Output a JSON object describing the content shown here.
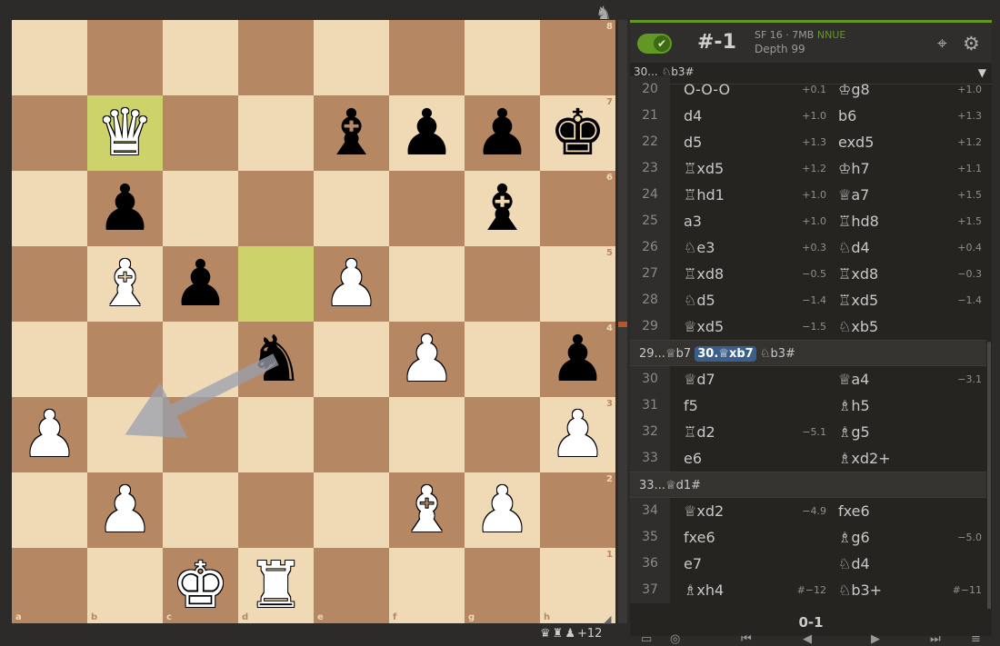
{
  "board": {
    "files": [
      "a",
      "b",
      "c",
      "d",
      "e",
      "f",
      "g",
      "h"
    ],
    "ranks": [
      "8",
      "7",
      "6",
      "5",
      "4",
      "3",
      "2",
      "1"
    ],
    "highlight_squares": [
      "b7",
      "d5"
    ],
    "pieces": [
      {
        "square": "b7",
        "color": "w",
        "type": "queen",
        "glyph": "♛"
      },
      {
        "square": "e7",
        "color": "b",
        "type": "bishop",
        "glyph": "♝"
      },
      {
        "square": "f7",
        "color": "b",
        "type": "pawn",
        "glyph": "♟"
      },
      {
        "square": "g7",
        "color": "b",
        "type": "pawn",
        "glyph": "♟"
      },
      {
        "square": "h7",
        "color": "b",
        "type": "king",
        "glyph": "♚"
      },
      {
        "square": "b6",
        "color": "b",
        "type": "pawn",
        "glyph": "♟"
      },
      {
        "square": "g6",
        "color": "b",
        "type": "bishop",
        "glyph": "♝"
      },
      {
        "square": "b5",
        "color": "w",
        "type": "bishop",
        "glyph": "♝"
      },
      {
        "square": "c5",
        "color": "b",
        "type": "pawn",
        "glyph": "♟"
      },
      {
        "square": "e5",
        "color": "w",
        "type": "pawn",
        "glyph": "♟"
      },
      {
        "square": "d4",
        "color": "b",
        "type": "knight",
        "glyph": "♞"
      },
      {
        "square": "f4",
        "color": "w",
        "type": "pawn",
        "glyph": "♟"
      },
      {
        "square": "h4",
        "color": "b",
        "type": "pawn",
        "glyph": "♟"
      },
      {
        "square": "a3",
        "color": "w",
        "type": "pawn",
        "glyph": "♟"
      },
      {
        "square": "h3",
        "color": "w",
        "type": "pawn",
        "glyph": "♟"
      },
      {
        "square": "b2",
        "color": "w",
        "type": "pawn",
        "glyph": "♟"
      },
      {
        "square": "f2",
        "color": "w",
        "type": "bishop",
        "glyph": "♝"
      },
      {
        "square": "g2",
        "color": "w",
        "type": "pawn",
        "glyph": "♟"
      },
      {
        "square": "c1",
        "color": "w",
        "type": "king",
        "glyph": "♚"
      },
      {
        "square": "d1",
        "color": "w",
        "type": "rook",
        "glyph": "♜"
      }
    ],
    "arrow": {
      "from": "d4",
      "to": "b3",
      "color": "#9aa0b0"
    }
  },
  "material": {
    "pieces": [
      "♛",
      "♜",
      "♟"
    ],
    "diff": "+12"
  },
  "engine": {
    "eval": "#-1",
    "name": "SF 16 · 7MB",
    "nnue": "NNUE",
    "depth": "Depth 99",
    "pv": "30... ♘b3#"
  },
  "moves": [
    {
      "type": "row",
      "num": "20",
      "w": "O-O-O",
      "we": "+0.1",
      "b": "♔g8",
      "be": "+1.0"
    },
    {
      "type": "row",
      "num": "21",
      "w": "d4",
      "we": "+1.0",
      "b": "b6",
      "be": "+1.3"
    },
    {
      "type": "row",
      "num": "22",
      "w": "d5",
      "we": "+1.3",
      "b": "exd5",
      "be": "+1.2"
    },
    {
      "type": "row",
      "num": "23",
      "w": "♖xd5",
      "we": "+1.2",
      "b": "♔h7",
      "be": "+1.1"
    },
    {
      "type": "row",
      "num": "24",
      "w": "♖hd1",
      "we": "+1.0",
      "b": "♕a7",
      "be": "+1.5"
    },
    {
      "type": "row",
      "num": "25",
      "w": "a3",
      "we": "+1.0",
      "b": "♖hd8",
      "be": "+1.5"
    },
    {
      "type": "row",
      "num": "26",
      "w": "♘e3",
      "we": "+0.3",
      "b": "♘d4",
      "be": "+0.4"
    },
    {
      "type": "row",
      "num": "27",
      "w": "♖xd8",
      "we": "−0.5",
      "b": "♖xd8",
      "be": "−0.3"
    },
    {
      "type": "row",
      "num": "28",
      "w": "♘d5",
      "we": "−1.4",
      "b": "♖xd5",
      "be": "−1.4"
    },
    {
      "type": "row",
      "num": "29",
      "w": "♕xd5",
      "we": "−1.5",
      "b": "♘xb5",
      "be": ""
    },
    {
      "type": "var",
      "pre": "29...♕b7",
      "cur": "30.♕xb7",
      "post": "♘b3#"
    },
    {
      "type": "row",
      "num": "30",
      "w": "♕d7",
      "we": "",
      "b": "♕a4",
      "be": "−3.1"
    },
    {
      "type": "row",
      "num": "31",
      "w": "f5",
      "we": "",
      "b": "♗h5",
      "be": ""
    },
    {
      "type": "row",
      "num": "32",
      "w": "♖d2",
      "we": "−5.1",
      "b": "♗g5",
      "be": ""
    },
    {
      "type": "row",
      "num": "33",
      "w": "e6",
      "we": "",
      "b": "♗xd2+",
      "be": ""
    },
    {
      "type": "var",
      "pre": "33...♕d1#",
      "cur": "",
      "post": ""
    },
    {
      "type": "row",
      "num": "34",
      "w": "♕xd2",
      "we": "−4.9",
      "b": "fxe6",
      "be": ""
    },
    {
      "type": "row",
      "num": "35",
      "w": "fxe6",
      "we": "",
      "b": "♗g6",
      "be": "−5.0"
    },
    {
      "type": "row",
      "num": "36",
      "w": "e7",
      "we": "",
      "b": "♘d4",
      "be": ""
    },
    {
      "type": "row",
      "num": "37",
      "w": "♗xh4",
      "we": "#−12",
      "b": "♘b3+",
      "be": "#−11"
    }
  ],
  "result": "0-1",
  "icons": {
    "toggle": "check-icon",
    "target": "crosshair-icon",
    "gear": "gear-icon",
    "caret": "caret-down-icon",
    "knight": "knight-icon"
  }
}
